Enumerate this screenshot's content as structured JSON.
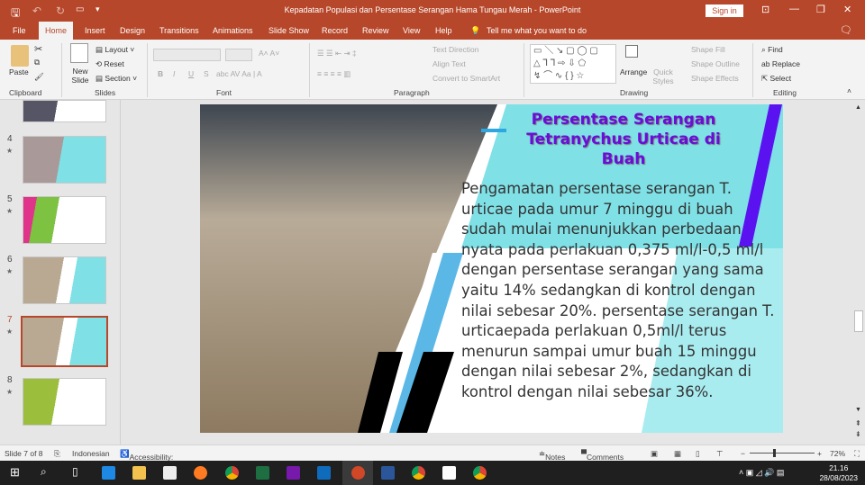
{
  "window": {
    "title": "Kepadatan Populasi dan Persentase Serangan Hama Tungau Merah  -  PowerPoint",
    "sign_in": "Sign in"
  },
  "tabs": [
    "File",
    "Home",
    "Insert",
    "Design",
    "Transitions",
    "Animations",
    "Slide Show",
    "Record",
    "Review",
    "View",
    "Help"
  ],
  "tell_me": "Tell me what you want to do",
  "ribbon": {
    "clipboard": {
      "paste": "Paste",
      "group": "Clipboard"
    },
    "slides": {
      "new_slide": "New Slide",
      "layout": "Layout",
      "reset": "Reset",
      "section": "Section",
      "group": "Slides"
    },
    "font": {
      "group": "Font",
      "bold": "B",
      "italic": "I",
      "underline": "U",
      "shadow": "S"
    },
    "paragraph": {
      "group": "Paragraph",
      "text_direction": "Text Direction",
      "align_text": "Align Text",
      "convert_smartart": "Convert to SmartArt"
    },
    "drawing": {
      "group": "Drawing",
      "arrange": "Arrange",
      "quick_styles": "Quick Styles",
      "shape_fill": "Shape Fill",
      "shape_outline": "Shape Outline",
      "shape_effects": "Shape Effects"
    },
    "editing": {
      "group": "Editing",
      "find": "Find",
      "replace": "Replace",
      "select": "Select"
    }
  },
  "thumbnails": [
    {
      "num": "4"
    },
    {
      "num": "5"
    },
    {
      "num": "6"
    },
    {
      "num": "7",
      "selected": true
    },
    {
      "num": "8"
    }
  ],
  "slide": {
    "title": "Persentase Serangan Tetranychus Urticae di Buah",
    "body": "Pengamatan persentase serangan T. urticae pada umur 7 minggu di buah sudah mulai menunjukkan perbedaan nyata pada perlakuan 0,375 ml/l-0,5 ml/l dengan persentase serangan yang sama yaitu 14% sedangkan di kontrol dengan nilai sebesar 20%. persentase serangan T. urticaepada perlakuan 0,5ml/l terus menurun sampai umur buah 15 minggu dengan nilai sebesar 2%, sedangkan di kontrol dengan nilai sebesar 36%."
  },
  "status": {
    "slide": "Slide 7 of 8",
    "language": "Indonesian",
    "accessibility": "Accessibility: Investigate",
    "notes": "Notes",
    "comments": "Comments",
    "zoom": "72%"
  },
  "clock": {
    "time": "21.16",
    "date": "28/08/2023"
  },
  "colors": {
    "accent": "#b7472a",
    "title_text": "#6a0dd8",
    "cyan": "#7fe0e6"
  }
}
